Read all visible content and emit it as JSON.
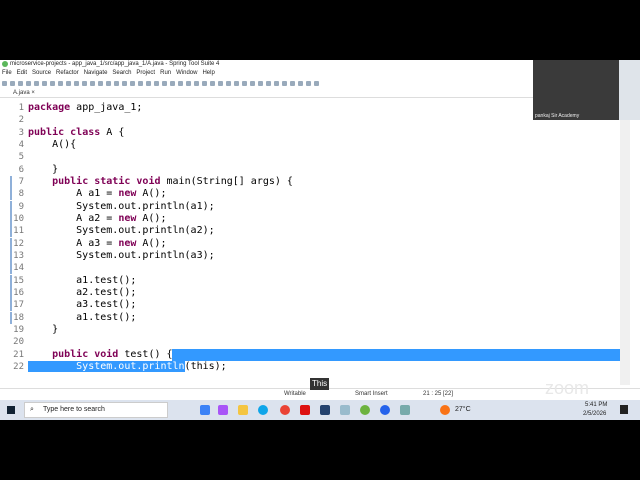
{
  "window": {
    "title": "microservice-projects - app_java_1/src/app_java_1/A.java - Spring Tool Suite 4"
  },
  "menu": [
    "File",
    "Edit",
    "Source",
    "Refactor",
    "Navigate",
    "Search",
    "Project",
    "Run",
    "Window",
    "Help"
  ],
  "tab": {
    "label": "A.java ×"
  },
  "code": [
    {
      "n": "1",
      "t": "package app_java_1;"
    },
    {
      "n": "2",
      "t": ""
    },
    {
      "n": "3",
      "t": "public class A {"
    },
    {
      "n": "4",
      "t": "    A(){"
    },
    {
      "n": "5",
      "t": ""
    },
    {
      "n": "6",
      "t": "    }"
    },
    {
      "n": "7",
      "t": "    public static void main(String[] args) {"
    },
    {
      "n": "8",
      "t": "        A a1 = new A();"
    },
    {
      "n": "9",
      "t": "        System.out.println(a1);"
    },
    {
      "n": "10",
      "t": "        A a2 = new A();"
    },
    {
      "n": "11",
      "t": "        System.out.println(a2);"
    },
    {
      "n": "12",
      "t": "        A a3 = new A();"
    },
    {
      "n": "13",
      "t": "        System.out.println(a3);"
    },
    {
      "n": "14",
      "t": ""
    },
    {
      "n": "15",
      "t": "        a1.test();"
    },
    {
      "n": "16",
      "t": "        a2.test();"
    },
    {
      "n": "17",
      "t": "        a3.test();"
    },
    {
      "n": "18",
      "t": "        a1.test();"
    },
    {
      "n": "19",
      "t": "    }"
    },
    {
      "n": "20",
      "t": ""
    },
    {
      "n": "21",
      "t": "    public void test() {"
    },
    {
      "n": "22",
      "t": "        System.out.println(this);"
    }
  ],
  "tooltip": "This",
  "status": {
    "mode": "Writable",
    "insert": "Smart Insert",
    "position": "21 : 25 [22]"
  },
  "webcam": {
    "name": "pankaj Sir Academy"
  },
  "taskbar": {
    "search_placeholder": "Type here to search",
    "weather": "27°C",
    "time": "5:41 PM",
    "date": "2/5/2026"
  },
  "zoom_watermark": "zoom"
}
